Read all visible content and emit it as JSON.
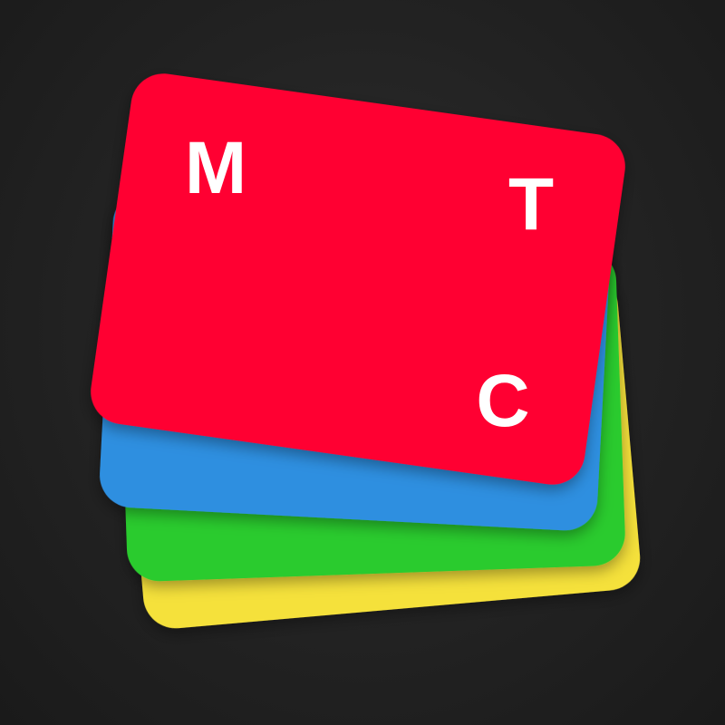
{
  "app_icon": {
    "letters": {
      "top_left": "M",
      "top_right": "T",
      "bottom_right": "C"
    },
    "cards": [
      {
        "name": "yellow",
        "color": "#f5e13b"
      },
      {
        "name": "green",
        "color": "#2ccb2e"
      },
      {
        "name": "blue",
        "color": "#2f8fe0"
      },
      {
        "name": "red",
        "color": "#ff0033"
      }
    ],
    "letter_color": "#ffffff"
  }
}
